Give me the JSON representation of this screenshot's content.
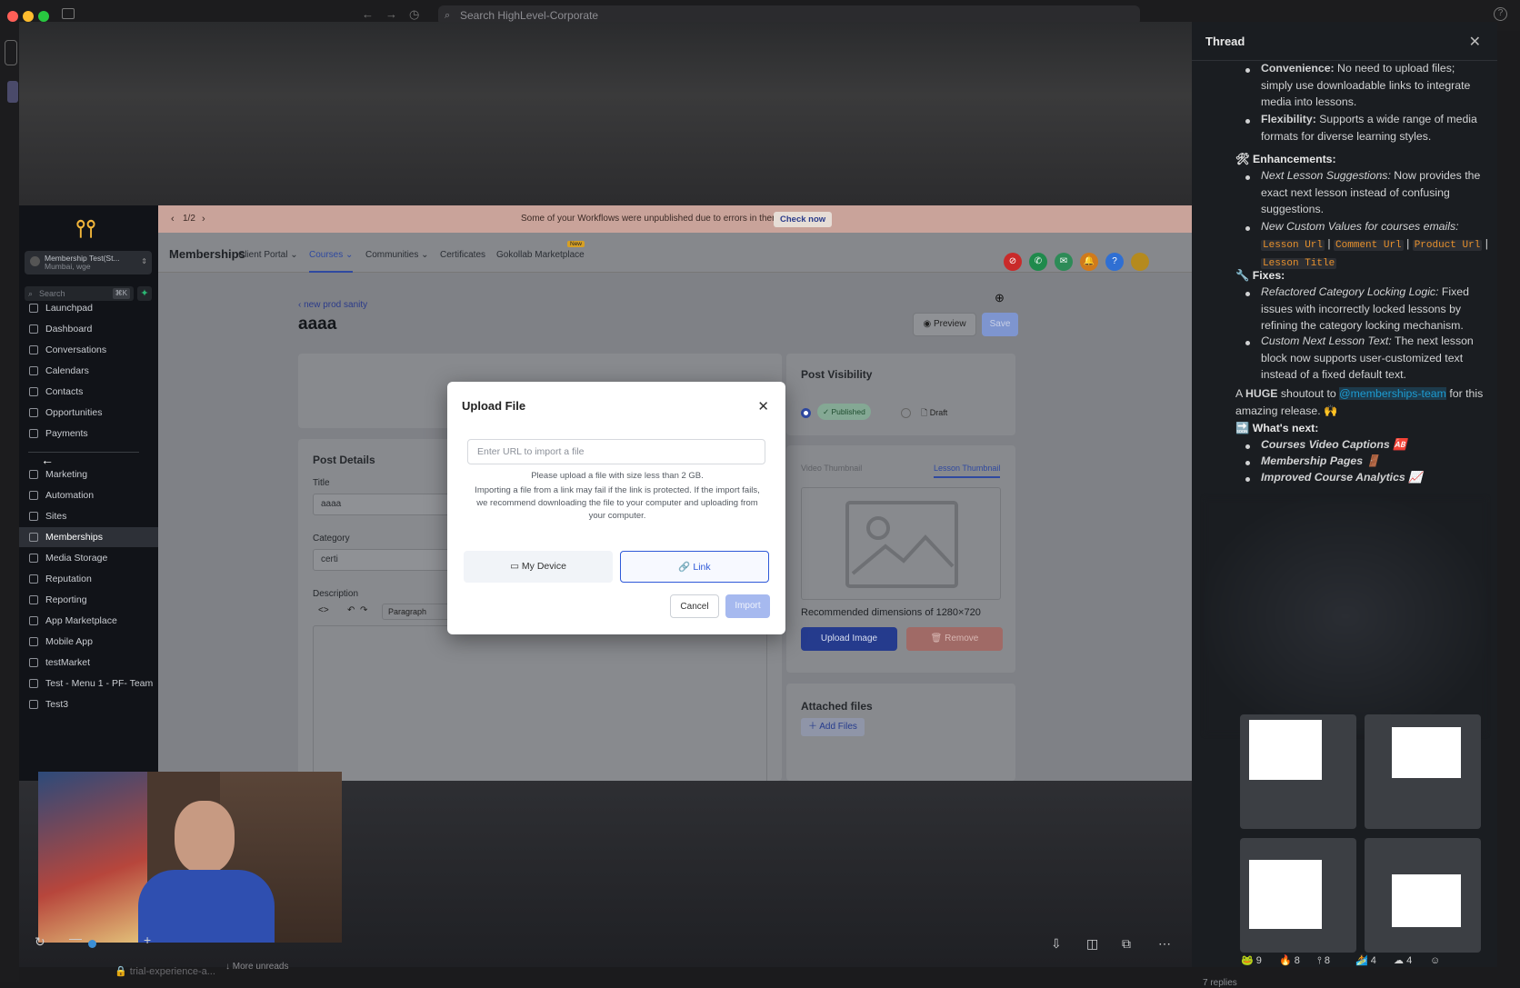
{
  "window": {
    "search_placeholder": "Search HighLevel-Corporate"
  },
  "sidebar": {
    "account_name": "Membership Test(St...",
    "account_sub": "Mumbai, wge",
    "search_placeholder": "Search",
    "search_kbd": "⌘K",
    "items": [
      {
        "label": "Launchpad",
        "icon": "rocket-icon"
      },
      {
        "label": "Dashboard",
        "icon": "dashboard-icon"
      },
      {
        "label": "Conversations",
        "icon": "chat-icon"
      },
      {
        "label": "Calendars",
        "icon": "calendar-icon"
      },
      {
        "label": "Contacts",
        "icon": "contacts-icon"
      },
      {
        "label": "Opportunities",
        "icon": "opportunities-icon"
      },
      {
        "label": "Payments",
        "icon": "payments-icon"
      },
      {
        "label": "Marketing",
        "icon": "marketing-icon"
      },
      {
        "label": "Automation",
        "icon": "automation-icon"
      },
      {
        "label": "Sites",
        "icon": "sites-icon"
      },
      {
        "label": "Memberships",
        "icon": "memberships-icon"
      },
      {
        "label": "Media Storage",
        "icon": "media-icon"
      },
      {
        "label": "Reputation",
        "icon": "star-icon"
      },
      {
        "label": "Reporting",
        "icon": "reporting-icon"
      },
      {
        "label": "App Marketplace",
        "icon": "marketplace-icon"
      },
      {
        "label": "Mobile App",
        "icon": "mobile-icon"
      },
      {
        "label": "testMarket",
        "icon": "link-icon"
      },
      {
        "label": "Test - Menu 1 - PF- Team",
        "icon": "link-icon"
      },
      {
        "label": "Test3",
        "icon": "link-icon"
      }
    ]
  },
  "banner": {
    "pager": "1/2",
    "message": "Some of your Workflows were unpublished due to errors in them.",
    "action": "Check now"
  },
  "topnav": {
    "title": "Memberships",
    "tabs": [
      "Client Portal",
      "Courses",
      "Communities",
      "Certificates",
      "Gokollab Marketplace"
    ],
    "new_badge": "New"
  },
  "page": {
    "breadcrumb": "new prod sanity",
    "title": "aaaa",
    "preview": "Preview",
    "save": "Save",
    "post_details": "Post Details",
    "title_label": "Title",
    "title_value": "aaaa",
    "category_label": "Category",
    "category_value": "certi",
    "description_label": "Description",
    "paragraph": "Paragraph",
    "visibility_title": "Post Visibility",
    "published": "Published",
    "draft": "Draft",
    "video_thumb_tab": "Video Thumbnail",
    "lesson_thumb_tab": "Lesson Thumbnail",
    "recommended": "Recommended dimensions of 1280×720",
    "upload_image": "Upload Image",
    "remove": "Remove",
    "attached_files": "Attached files",
    "add_files": "Add Files"
  },
  "modal": {
    "title": "Upload File",
    "url_placeholder": "Enter URL to import a file",
    "help1": "Please upload a file with size less than 2 GB.",
    "help2": "Importing a file from a link may fail if the link is protected. If the import fails, we recommend downloading the file to your computer and uploading from your computer.",
    "tab_device": "My Device",
    "tab_link": "Link",
    "cancel": "Cancel",
    "import": "Import"
  },
  "thread": {
    "title": "Thread",
    "convenience_b": "Convenience:",
    "convenience_t": " No need to upload files; simply use downloadable links to integrate media into lessons.",
    "flexibility_b": "Flexibility:",
    "flexibility_t": " Supports a wide range of media formats for diverse learning styles.",
    "enh_header": "Enhancements:",
    "next_lesson_i": "Next Lesson Suggestions:",
    "next_lesson_t": " Now provides the exact next lesson instead of confusing suggestions.",
    "custom_values_i": "New Custom Values for courses emails:",
    "code1": "Lesson Url",
    "code2": "Comment Url",
    "code3": "Product Url",
    "code4": "Lesson Title",
    "fixes_header": "Fixes:",
    "refactored_i": "Refactored Category Locking Logic:",
    "refactored_t": " Fixed issues with incorrectly locked lessons by refining the category locking mechanism.",
    "custom_next_i": "Custom Next Lesson Text:",
    "custom_next_t": " The next lesson block now supports user-customized text instead of a fixed default text.",
    "shout_a": "A ",
    "shout_b": "HUGE",
    "shout_c": " shoutout to ",
    "mention": "@memberships-team",
    "shout_d": " for this amazing release. 🙌",
    "next_header": "What's next:",
    "next1": "Courses Video Captions",
    "next2": "Membership Pages",
    "next3": "Improved Course Analytics",
    "reactions": [
      "9",
      "8",
      "8",
      "4",
      "4"
    ],
    "replies": "7 replies"
  },
  "taskbar": {
    "channel": "trial-experience-a...",
    "more_unreads": "More unreads"
  }
}
